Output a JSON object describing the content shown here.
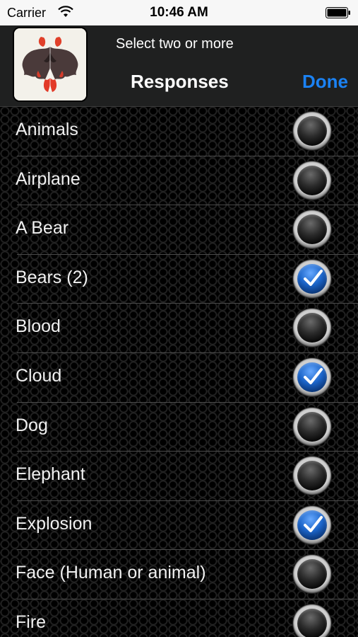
{
  "status_bar": {
    "carrier": "Carrier",
    "time": "10:46 AM"
  },
  "header": {
    "subtitle": "Select two or more",
    "title": "Responses",
    "done_label": "Done",
    "accent_color": "#1b82f3"
  },
  "list": {
    "items": [
      {
        "label": "Animals",
        "checked": false
      },
      {
        "label": "Airplane",
        "checked": false
      },
      {
        "label": "A Bear",
        "checked": false
      },
      {
        "label": "Bears (2)",
        "checked": true
      },
      {
        "label": "Blood",
        "checked": false
      },
      {
        "label": "Cloud",
        "checked": true
      },
      {
        "label": "Dog",
        "checked": false
      },
      {
        "label": "Elephant",
        "checked": false
      },
      {
        "label": "Explosion",
        "checked": true
      },
      {
        "label": "Face (Human or animal)",
        "checked": false
      },
      {
        "label": "Fire",
        "checked": false
      }
    ]
  },
  "icons": {
    "wifi": "wifi-icon",
    "battery": "battery-icon",
    "check": "checkmark-icon",
    "thumbnail": "inkblot-image"
  }
}
